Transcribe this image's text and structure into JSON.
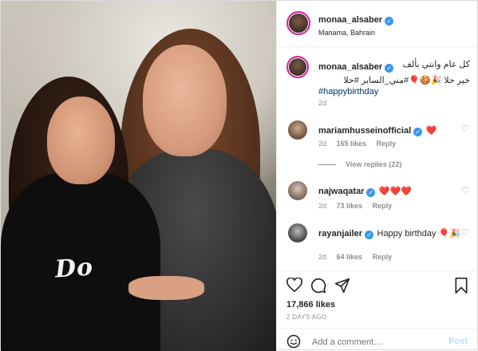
{
  "post": {
    "author": "monaa_alsaber",
    "location": "Manama, Bahrain",
    "caption_line1": "كل عام وانتي بألف",
    "caption_line2": "خير حلا 🎉🍪🎈#مني_الساير #حلا",
    "caption_hashtag": "#happybirthday",
    "caption_age": "2d",
    "likes": "17,866 likes",
    "date": "2 DAYS AGO",
    "photo_text": "Do"
  },
  "comments": [
    {
      "user": "mariamhusseinofficial",
      "text": "❤️",
      "age": "2d",
      "likes": "165 likes",
      "reply": "Reply",
      "view_replies": "View replies (22)"
    },
    {
      "user": "najwaqatar",
      "text": "❤️❤️❤️",
      "age": "2d",
      "likes": "73 likes",
      "reply": "Reply"
    },
    {
      "user": "rayanjailer",
      "text": "Happy birthday 🎈🎉",
      "age": "2d",
      "likes": "64 likes",
      "reply": "Reply"
    }
  ],
  "composer": {
    "placeholder": "Add a comment…",
    "post_label": "Post"
  },
  "icons": {
    "like": "heart-icon",
    "comment": "comment-icon",
    "share": "share-icon",
    "save": "bookmark-icon",
    "emoji": "emoji-icon",
    "verified": "verified-badge-icon"
  },
  "colors": {
    "verified": "#3897f0",
    "ring": "#d6249f",
    "post_disabled": "#b2dffc",
    "heart_red": "#ed4956"
  }
}
